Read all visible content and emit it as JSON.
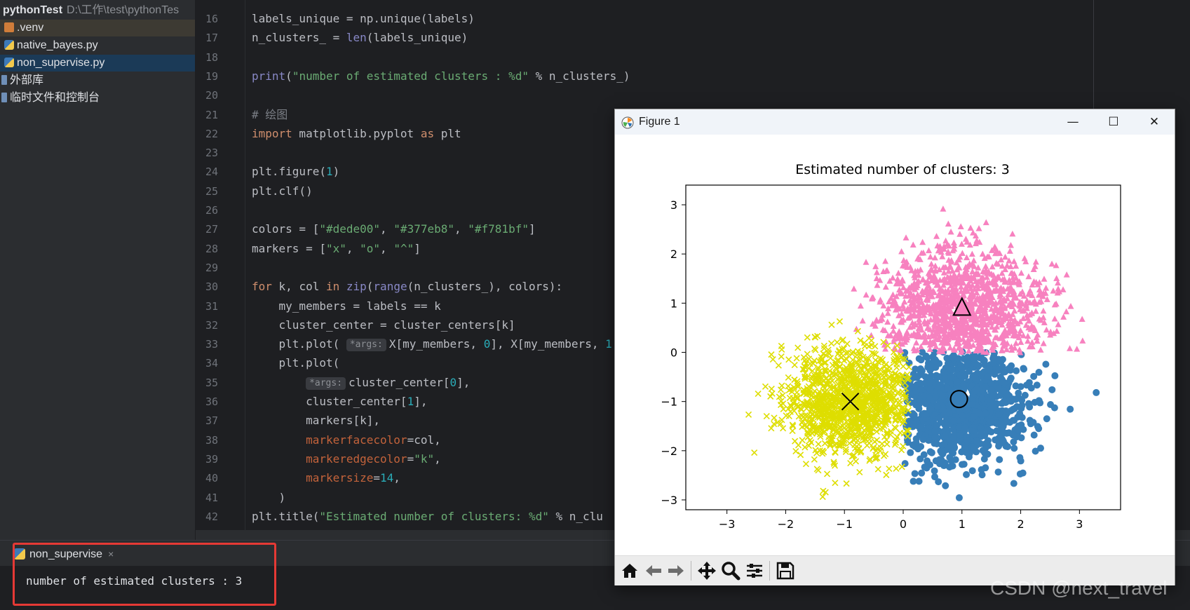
{
  "project_tree": {
    "root_name": "pythonTest",
    "root_path": "D:\\工作\\test\\pythonTes",
    "items": [
      {
        "label": ".venv",
        "icon": "folder-icon"
      },
      {
        "label": "native_bayes.py",
        "icon": "python-file-icon"
      },
      {
        "label": "non_supervise.py",
        "icon": "python-file-icon",
        "selected": true
      },
      {
        "label": "外部库",
        "icon": "library-icon"
      },
      {
        "label": "临时文件和控制台",
        "icon": "scratch-icon"
      }
    ]
  },
  "editor": {
    "first_line": 16,
    "lines": [
      [
        [
          "t",
          "labels_unique = np.unique(labels)"
        ]
      ],
      [
        [
          "t",
          "n_clusters_ = "
        ],
        [
          "bi",
          "len"
        ],
        [
          "t",
          "(labels_unique)"
        ]
      ],
      [],
      [
        [
          "bi",
          "print"
        ],
        [
          "t",
          "("
        ],
        [
          "str",
          "\"number of estimated clusters : %d\""
        ],
        [
          "t",
          " % n_clusters_)"
        ]
      ],
      [],
      [
        [
          "cm",
          "# 绘图"
        ]
      ],
      [
        [
          "kw",
          "import"
        ],
        [
          "t",
          " matplotlib.pyplot "
        ],
        [
          "kw",
          "as"
        ],
        [
          "t",
          " plt"
        ]
      ],
      [],
      [
        [
          "t",
          "plt.figure("
        ],
        [
          "num",
          "1"
        ],
        [
          "t",
          ")"
        ]
      ],
      [
        [
          "t",
          "plt.clf()"
        ]
      ],
      [],
      [
        [
          "t",
          "colors = ["
        ],
        [
          "str",
          "\"#dede00\""
        ],
        [
          "t",
          ", "
        ],
        [
          "str",
          "\"#377eb8\""
        ],
        [
          "t",
          ", "
        ],
        [
          "str",
          "\"#f781bf\""
        ],
        [
          "t",
          "]"
        ]
      ],
      [
        [
          "t",
          "markers = ["
        ],
        [
          "str",
          "\"x\""
        ],
        [
          "t",
          ", "
        ],
        [
          "str",
          "\"o\""
        ],
        [
          "t",
          ", "
        ],
        [
          "str",
          "\"^\""
        ],
        [
          "t",
          "]"
        ]
      ],
      [],
      [
        [
          "kw",
          "for"
        ],
        [
          "t",
          " k, col "
        ],
        [
          "kw",
          "in"
        ],
        [
          "t",
          " "
        ],
        [
          "bi",
          "zip"
        ],
        [
          "t",
          "("
        ],
        [
          "bi",
          "range"
        ],
        [
          "t",
          "(n_clusters_), colors):"
        ]
      ],
      [
        [
          "t",
          "    my_members = labels == k"
        ]
      ],
      [
        [
          "t",
          "    cluster_center = cluster_centers[k]"
        ]
      ],
      [
        [
          "t",
          "    plt.plot( "
        ],
        [
          "hint",
          "*args:"
        ],
        [
          "t",
          "X[my_members, "
        ],
        [
          "num",
          "0"
        ],
        [
          "t",
          "], X[my_members, "
        ],
        [
          "num",
          "1"
        ]
      ],
      [
        [
          "t",
          "    plt.plot("
        ]
      ],
      [
        [
          "t",
          "        "
        ],
        [
          "hint",
          "*args:"
        ],
        [
          "t",
          "cluster_center["
        ],
        [
          "num",
          "0"
        ],
        [
          "t",
          "],"
        ]
      ],
      [
        [
          "t",
          "        cluster_center["
        ],
        [
          "num",
          "1"
        ],
        [
          "t",
          "],"
        ]
      ],
      [
        [
          "t",
          "        markers[k],"
        ]
      ],
      [
        [
          "t",
          "        "
        ],
        [
          "kwarg",
          "markerfacecolor"
        ],
        [
          "t",
          "=col,"
        ]
      ],
      [
        [
          "t",
          "        "
        ],
        [
          "kwarg",
          "markeredgecolor"
        ],
        [
          "t",
          "="
        ],
        [
          "str",
          "\"k\""
        ],
        [
          "t",
          ","
        ]
      ],
      [
        [
          "t",
          "        "
        ],
        [
          "kwarg",
          "markersize"
        ],
        [
          "t",
          "="
        ],
        [
          "num",
          "14"
        ],
        [
          "t",
          ","
        ]
      ],
      [
        [
          "t",
          "    )"
        ]
      ],
      [
        [
          "t",
          "plt.title("
        ],
        [
          "str",
          "\"Estimated number of clusters: %d\""
        ],
        [
          "t",
          " % n_clu"
        ]
      ]
    ]
  },
  "run_panel": {
    "tab_label": "non_supervise",
    "tab_close": "×",
    "output": "number of estimated clusters : 3"
  },
  "figure_window": {
    "title": "Figure 1",
    "minimize": "—",
    "maximize": "☐",
    "close": "✕",
    "toolbar": [
      "home-icon",
      "back-icon",
      "forward-icon",
      "pan-icon",
      "zoom-icon",
      "configure-subplots-icon",
      "save-icon"
    ]
  },
  "chart_data": {
    "type": "scatter",
    "title": "Estimated number of clusters: 3",
    "xlabel": "",
    "ylabel": "",
    "xlim": [
      -3.7,
      3.7
    ],
    "ylim": [
      -3.2,
      3.4
    ],
    "xticks": [
      -3,
      -2,
      -1,
      0,
      1,
      2,
      3
    ],
    "yticks": [
      -3,
      -2,
      -1,
      0,
      1,
      2,
      3
    ],
    "xtick_labels": [
      "−3",
      "−2",
      "−1",
      "0",
      "1",
      "2",
      "3"
    ],
    "ytick_labels": [
      "−3",
      "−2",
      "−1",
      "0",
      "1",
      "2",
      "3"
    ],
    "grid": false,
    "series": [
      {
        "color": "#dede00",
        "marker": "x",
        "center": [
          -0.9,
          -1.0
        ],
        "region": "x < 0, y < 0 (plus overlap)"
      },
      {
        "color": "#377eb8",
        "marker": "o",
        "center": [
          0.95,
          -0.95
        ],
        "region": "x > 0, y < 0"
      },
      {
        "color": "#f781bf",
        "marker": "^",
        "center": [
          1.0,
          0.9
        ],
        "region": "y > 0"
      }
    ]
  },
  "watermark": "CSDN @next_travel"
}
